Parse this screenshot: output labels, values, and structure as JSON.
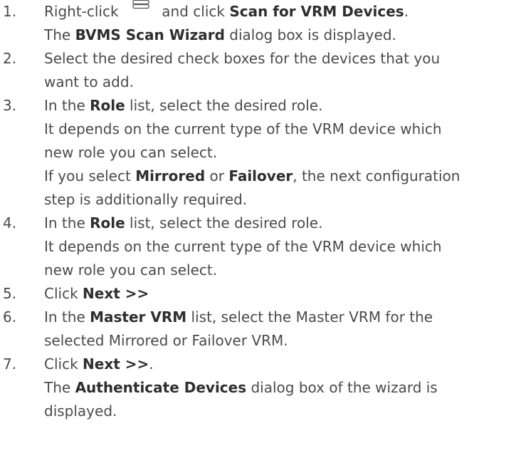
{
  "steps": [
    {
      "number": "1.",
      "line1": {
        "a": "Right-click",
        "b": "and click",
        "c": "Scan for VRM Devices",
        "d": "."
      },
      "line2": {
        "a": "The",
        "b": "BVMS Scan Wizard",
        "c": "dialog box is displayed."
      }
    },
    {
      "number": "2.",
      "line1": "Select the desired check boxes for the devices that you",
      "line2": "want to add."
    },
    {
      "number": "3.",
      "line1": {
        "a": "In the",
        "b": "Role",
        "c": "list, select the desired role."
      },
      "line2": "It depends on the current type of the VRM device which",
      "line3": "new role you can select.",
      "line4": {
        "a": "If you select",
        "b": "Mirrored",
        "c": "or",
        "d": "Failover",
        "e": ", the next configuration"
      },
      "line5": "step is additionally required."
    },
    {
      "number": "4.",
      "line1": {
        "a": "In the",
        "b": "Role",
        "c": "list, select the desired role."
      },
      "line2": "It depends on the current type of the VRM device which",
      "line3": "new role you can select."
    },
    {
      "number": "5.",
      "line1": {
        "a": "Click",
        "b": "Next >>"
      }
    },
    {
      "number": "6.",
      "line1": {
        "a": "In the",
        "b": "Master VRM",
        "c": "list, select the Master VRM for the"
      },
      "line2": "selected Mirrored or Failover VRM."
    },
    {
      "number": "7.",
      "line1": {
        "a": "Click",
        "b": "Next >>",
        "c": "."
      },
      "line2": {
        "a": "The",
        "b": "Authenticate Devices",
        "c": "dialog box of the wizard is"
      },
      "line3": "displayed."
    }
  ],
  "icons": {
    "step1_icon": "vrm-devices-icon"
  }
}
